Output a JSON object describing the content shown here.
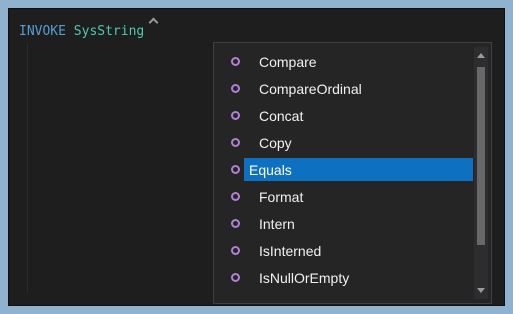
{
  "editor": {
    "keyword": "INVOKE",
    "identifier": "SysString"
  },
  "completion": {
    "items": [
      {
        "label": "Compare",
        "icon": "method-icon"
      },
      {
        "label": "CompareOrdinal",
        "icon": "method-icon"
      },
      {
        "label": "Concat",
        "icon": "method-icon"
      },
      {
        "label": "Copy",
        "icon": "method-icon"
      },
      {
        "label": "Equals",
        "icon": "method-icon",
        "selected": true
      },
      {
        "label": "Format",
        "icon": "method-icon"
      },
      {
        "label": "Intern",
        "icon": "method-icon"
      },
      {
        "label": "IsInterned",
        "icon": "method-icon"
      },
      {
        "label": "IsNullOrEmpty",
        "icon": "method-icon"
      }
    ],
    "selected_index": 4
  },
  "colors": {
    "background": "#8fb3cf",
    "editor_bg": "#1e1e1e",
    "keyword": "#569cd6",
    "identifier": "#4ec9b0",
    "selection": "#0e70c0",
    "method_icon": "#b180d7"
  }
}
